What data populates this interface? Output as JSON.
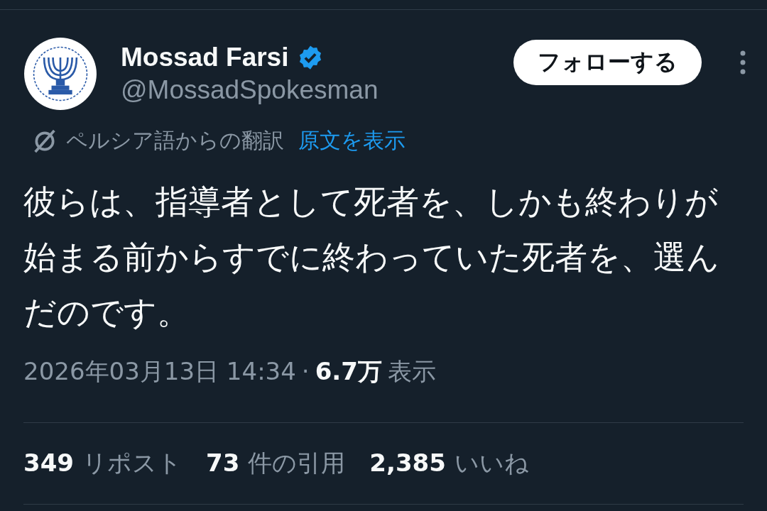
{
  "author": {
    "name": "Mossad Farsi",
    "verified": true,
    "handle": "@MossadSpokesman"
  },
  "follow_button": {
    "label": "フォローする"
  },
  "translation": {
    "note": "ペルシア語からの翻訳",
    "link": "原文を表示"
  },
  "text": "彼らは、指導者として死者を、しかも終わりが始まる前からすでに終わっていた死者を、選んだのです。",
  "meta": {
    "timestamp": "2026年03月13日 14:34",
    "separator": "·",
    "views_count": "6.7万",
    "views_label": "表示"
  },
  "stats": [
    {
      "count": "349",
      "label": "リポスト"
    },
    {
      "count": "73",
      "label": "件の引用"
    },
    {
      "count": "2,385",
      "label": "いいね"
    }
  ]
}
